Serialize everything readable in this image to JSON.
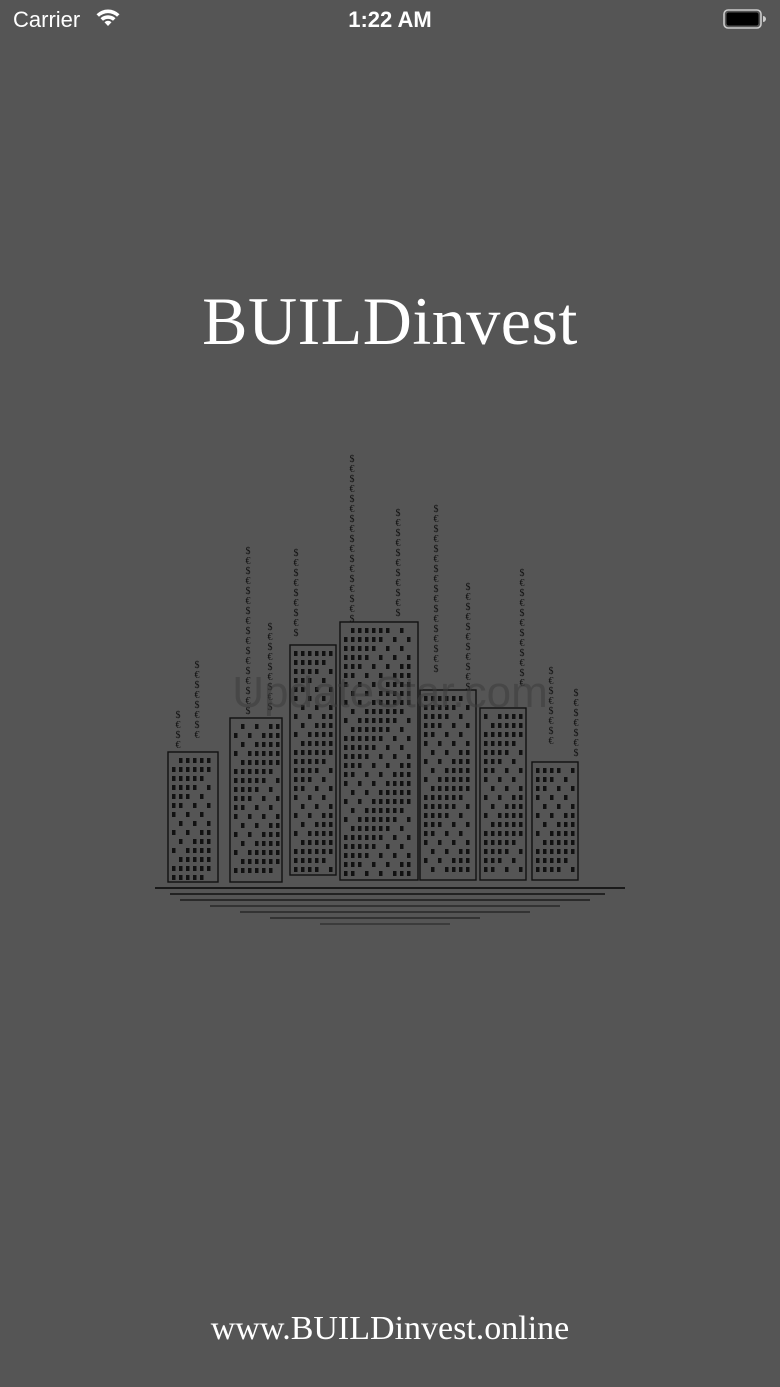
{
  "status_bar": {
    "carrier": "Carrier",
    "time": "1:22 AM",
    "icons": [
      "wifi-icon",
      "battery-icon"
    ]
  },
  "splash": {
    "title": "BUILDinvest",
    "logo_icon": "city-skyline-currency-icon",
    "watermark": "UpdateStar.com",
    "website": "www.BUILDinvest.online"
  },
  "colors": {
    "background": "#555555",
    "text": "#ffffff",
    "logo_ink": "#111111"
  }
}
